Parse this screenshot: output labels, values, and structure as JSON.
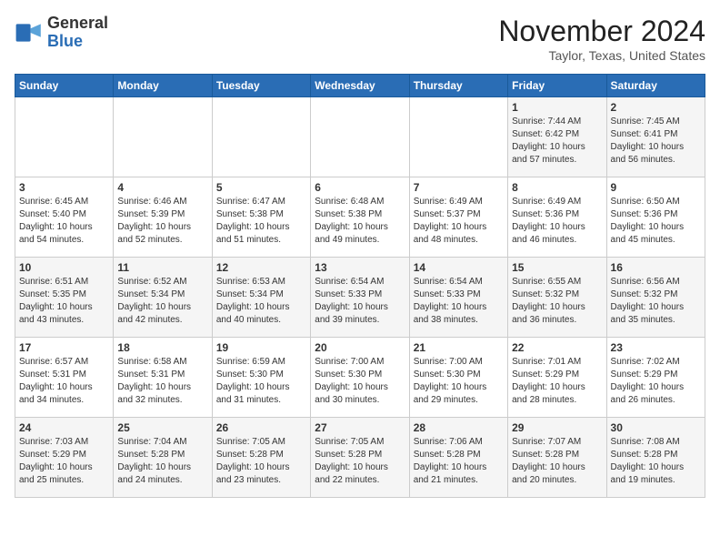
{
  "header": {
    "logo_general": "General",
    "logo_blue": "Blue",
    "month": "November 2024",
    "location": "Taylor, Texas, United States"
  },
  "days_of_week": [
    "Sunday",
    "Monday",
    "Tuesday",
    "Wednesday",
    "Thursday",
    "Friday",
    "Saturday"
  ],
  "weeks": [
    [
      {
        "day": "",
        "text": ""
      },
      {
        "day": "",
        "text": ""
      },
      {
        "day": "",
        "text": ""
      },
      {
        "day": "",
        "text": ""
      },
      {
        "day": "",
        "text": ""
      },
      {
        "day": "1",
        "text": "Sunrise: 7:44 AM\nSunset: 6:42 PM\nDaylight: 10 hours and 57 minutes."
      },
      {
        "day": "2",
        "text": "Sunrise: 7:45 AM\nSunset: 6:41 PM\nDaylight: 10 hours and 56 minutes."
      }
    ],
    [
      {
        "day": "3",
        "text": "Sunrise: 6:45 AM\nSunset: 5:40 PM\nDaylight: 10 hours and 54 minutes."
      },
      {
        "day": "4",
        "text": "Sunrise: 6:46 AM\nSunset: 5:39 PM\nDaylight: 10 hours and 52 minutes."
      },
      {
        "day": "5",
        "text": "Sunrise: 6:47 AM\nSunset: 5:38 PM\nDaylight: 10 hours and 51 minutes."
      },
      {
        "day": "6",
        "text": "Sunrise: 6:48 AM\nSunset: 5:38 PM\nDaylight: 10 hours and 49 minutes."
      },
      {
        "day": "7",
        "text": "Sunrise: 6:49 AM\nSunset: 5:37 PM\nDaylight: 10 hours and 48 minutes."
      },
      {
        "day": "8",
        "text": "Sunrise: 6:49 AM\nSunset: 5:36 PM\nDaylight: 10 hours and 46 minutes."
      },
      {
        "day": "9",
        "text": "Sunrise: 6:50 AM\nSunset: 5:36 PM\nDaylight: 10 hours and 45 minutes."
      }
    ],
    [
      {
        "day": "10",
        "text": "Sunrise: 6:51 AM\nSunset: 5:35 PM\nDaylight: 10 hours and 43 minutes."
      },
      {
        "day": "11",
        "text": "Sunrise: 6:52 AM\nSunset: 5:34 PM\nDaylight: 10 hours and 42 minutes."
      },
      {
        "day": "12",
        "text": "Sunrise: 6:53 AM\nSunset: 5:34 PM\nDaylight: 10 hours and 40 minutes."
      },
      {
        "day": "13",
        "text": "Sunrise: 6:54 AM\nSunset: 5:33 PM\nDaylight: 10 hours and 39 minutes."
      },
      {
        "day": "14",
        "text": "Sunrise: 6:54 AM\nSunset: 5:33 PM\nDaylight: 10 hours and 38 minutes."
      },
      {
        "day": "15",
        "text": "Sunrise: 6:55 AM\nSunset: 5:32 PM\nDaylight: 10 hours and 36 minutes."
      },
      {
        "day": "16",
        "text": "Sunrise: 6:56 AM\nSunset: 5:32 PM\nDaylight: 10 hours and 35 minutes."
      }
    ],
    [
      {
        "day": "17",
        "text": "Sunrise: 6:57 AM\nSunset: 5:31 PM\nDaylight: 10 hours and 34 minutes."
      },
      {
        "day": "18",
        "text": "Sunrise: 6:58 AM\nSunset: 5:31 PM\nDaylight: 10 hours and 32 minutes."
      },
      {
        "day": "19",
        "text": "Sunrise: 6:59 AM\nSunset: 5:30 PM\nDaylight: 10 hours and 31 minutes."
      },
      {
        "day": "20",
        "text": "Sunrise: 7:00 AM\nSunset: 5:30 PM\nDaylight: 10 hours and 30 minutes."
      },
      {
        "day": "21",
        "text": "Sunrise: 7:00 AM\nSunset: 5:30 PM\nDaylight: 10 hours and 29 minutes."
      },
      {
        "day": "22",
        "text": "Sunrise: 7:01 AM\nSunset: 5:29 PM\nDaylight: 10 hours and 28 minutes."
      },
      {
        "day": "23",
        "text": "Sunrise: 7:02 AM\nSunset: 5:29 PM\nDaylight: 10 hours and 26 minutes."
      }
    ],
    [
      {
        "day": "24",
        "text": "Sunrise: 7:03 AM\nSunset: 5:29 PM\nDaylight: 10 hours and 25 minutes."
      },
      {
        "day": "25",
        "text": "Sunrise: 7:04 AM\nSunset: 5:28 PM\nDaylight: 10 hours and 24 minutes."
      },
      {
        "day": "26",
        "text": "Sunrise: 7:05 AM\nSunset: 5:28 PM\nDaylight: 10 hours and 23 minutes."
      },
      {
        "day": "27",
        "text": "Sunrise: 7:05 AM\nSunset: 5:28 PM\nDaylight: 10 hours and 22 minutes."
      },
      {
        "day": "28",
        "text": "Sunrise: 7:06 AM\nSunset: 5:28 PM\nDaylight: 10 hours and 21 minutes."
      },
      {
        "day": "29",
        "text": "Sunrise: 7:07 AM\nSunset: 5:28 PM\nDaylight: 10 hours and 20 minutes."
      },
      {
        "day": "30",
        "text": "Sunrise: 7:08 AM\nSunset: 5:28 PM\nDaylight: 10 hours and 19 minutes."
      }
    ]
  ]
}
